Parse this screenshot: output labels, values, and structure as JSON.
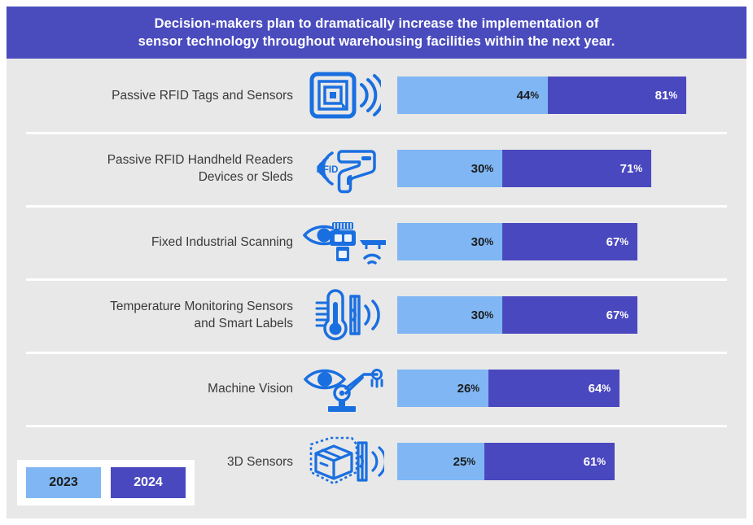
{
  "header": {
    "title": "Decision-makers plan to dramatically increase the implementation of\nsensor technology throughout warehousing facilities within the next year.",
    "background_color": "#4a4cbe",
    "text_color": "#ffffff"
  },
  "legend": {
    "items": [
      {
        "label": "2023",
        "color": "#7fb6f3",
        "text_color": "#1c1c1c"
      },
      {
        "label": "2024",
        "color": "#4a48bf",
        "text_color": "#ffffff"
      }
    ]
  },
  "colors": {
    "canvas_background": "#e8e8e8",
    "page_background": "#ffffff",
    "series_2023": "#7fb6f3",
    "series_2024": "#4a48bf",
    "banner": "#4a4cbe",
    "icon_blue": "#1a6fe0",
    "label_text": "#3a3a3a",
    "row_divider": "#ffffff"
  },
  "rows": [
    {
      "label": "Passive RFID Tags and Sensors",
      "icon": "rfid-tag-signal-icon",
      "v2023": "44",
      "v2024": "81",
      "suffix": "%"
    },
    {
      "label": "Passive RFID Handheld Readers\nDevices or Sleds",
      "icon": "rfid-handheld-reader-icon",
      "v2023": "30",
      "v2024": "71",
      "suffix": "%"
    },
    {
      "label": "Fixed Industrial Scanning",
      "icon": "fixed-industrial-scanner-icon",
      "v2023": "30",
      "v2024": "67",
      "suffix": "%"
    },
    {
      "label": "Temperature Monitoring Sensors\nand Smart Labels",
      "icon": "thermometer-smart-label-icon",
      "v2023": "30",
      "v2024": "67",
      "suffix": "%"
    },
    {
      "label": "Machine Vision",
      "icon": "machine-vision-robot-arm-icon",
      "v2023": "26",
      "v2024": "64",
      "suffix": "%"
    },
    {
      "label": "3D Sensors",
      "icon": "three-d-box-sensor-icon",
      "v2023": "25",
      "v2024": "61",
      "suffix": "%"
    }
  ],
  "chart_data": {
    "type": "bar",
    "orientation": "horizontal",
    "stacked": false,
    "title": "Decision-makers plan to dramatically increase the implementation of sensor technology throughout warehousing facilities within the next year.",
    "xlabel": "",
    "ylabel": "",
    "xlim": [
      0,
      100
    ],
    "grid": false,
    "legend_position": "bottom-left",
    "value_unit": "%",
    "categories": [
      "Passive RFID Tags and Sensors",
      "Passive RFID Handheld Readers Devices or Sleds",
      "Fixed Industrial Scanning",
      "Temperature Monitoring Sensors and Smart Labels",
      "Machine Vision",
      "3D Sensors"
    ],
    "series": [
      {
        "name": "2023",
        "color": "#7fb6f3",
        "values": [
          44,
          30,
          30,
          30,
          26,
          25
        ]
      },
      {
        "name": "2024",
        "color": "#4a48bf",
        "values": [
          81,
          71,
          67,
          67,
          64,
          61
        ]
      }
    ]
  }
}
